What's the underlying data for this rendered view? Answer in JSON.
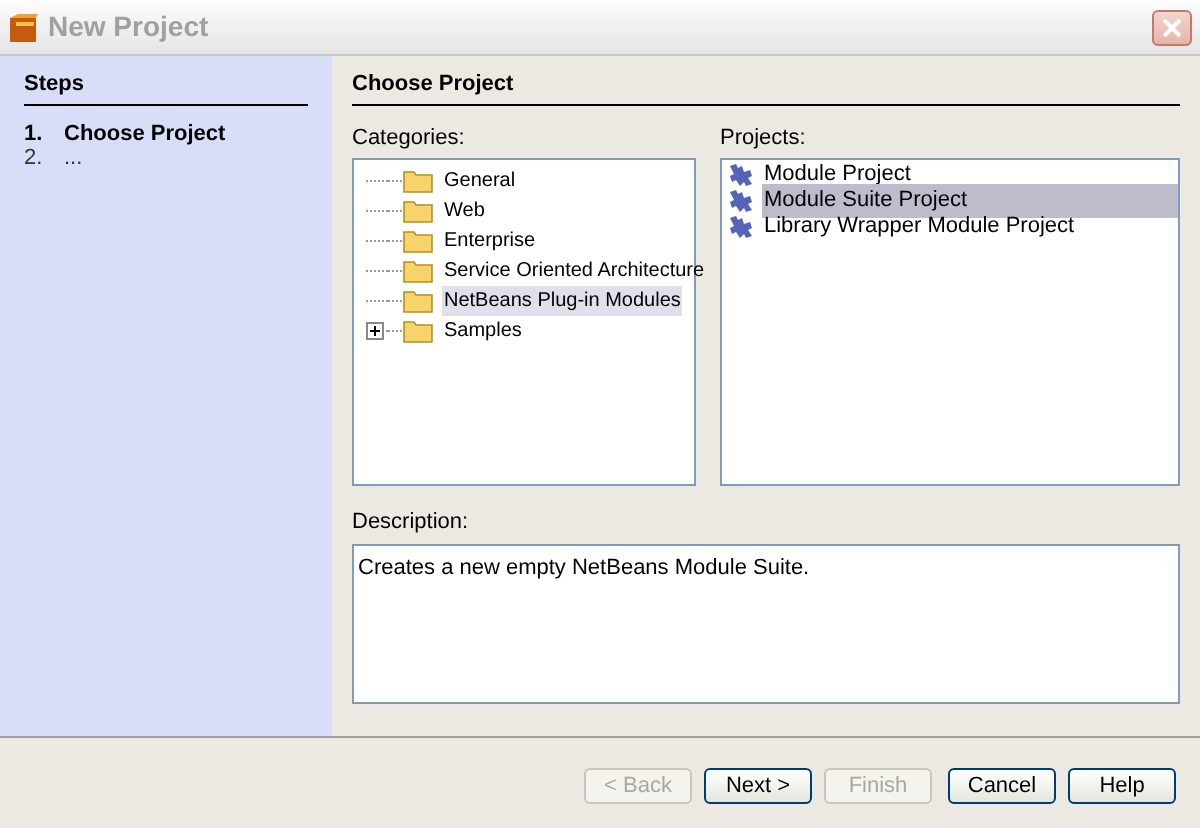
{
  "window": {
    "title": "New Project"
  },
  "steps": {
    "title": "Steps",
    "items": [
      {
        "number": "1.",
        "label": "Choose Project",
        "selected": true
      },
      {
        "number": "2.",
        "label": "...",
        "selected": false
      }
    ]
  },
  "panel_title": "Choose Project",
  "categories": {
    "label": "Categories:",
    "items": [
      {
        "label": "General",
        "selected": false,
        "expandable": false
      },
      {
        "label": "Web",
        "selected": false,
        "expandable": false
      },
      {
        "label": "Enterprise",
        "selected": false,
        "expandable": false
      },
      {
        "label": "Service Oriented Architecture",
        "selected": false,
        "expandable": false
      },
      {
        "label": "NetBeans Plug-in Modules",
        "selected": true,
        "expandable": false
      },
      {
        "label": "Samples",
        "selected": false,
        "expandable": true
      }
    ]
  },
  "projects": {
    "label": "Projects:",
    "items": [
      {
        "label": "Module Project",
        "selected": false
      },
      {
        "label": "Module Suite Project",
        "selected": true
      },
      {
        "label": "Library Wrapper Module Project",
        "selected": false
      }
    ]
  },
  "description": {
    "label": "Description:",
    "value": "Creates a new empty NetBeans Module Suite."
  },
  "buttons": [
    {
      "label": "< Back",
      "disabled": true
    },
    {
      "label": "Next >",
      "disabled": false
    },
    {
      "label": "Finish",
      "disabled": true
    },
    {
      "label": "Cancel",
      "disabled": false
    },
    {
      "label": "Help",
      "disabled": false
    }
  ]
}
